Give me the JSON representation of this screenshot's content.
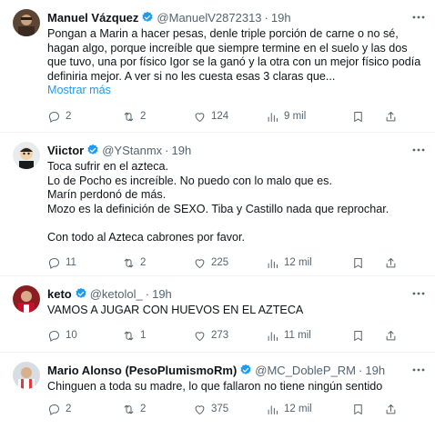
{
  "colors": {
    "text": "#0f1419",
    "muted": "#536471",
    "link": "#1d9bf0",
    "verified": "#1d9bf0",
    "divider": "#eff3f4"
  },
  "tweets": [
    {
      "name": "Manuel Vázquez",
      "verified": true,
      "handle": "@ManuelV2872313",
      "time": "19h",
      "text": "Pongan a Marin a hacer pesas, denle triple porción de carne o no sé, hagan algo, porque increíble que siempre termine en el suelo y las dos que tuvo, una por físico Igor se la ganó y la otra con un mejor físico podía definiria mejor. A ver si no les cuesta esas 3 claras que...",
      "show_more": "Mostrar más",
      "replies": "2",
      "retweets": "2",
      "likes": "124",
      "views": "9 mil"
    },
    {
      "name": "Viictor",
      "verified": true,
      "handle": "@YStanmx",
      "time": "19h",
      "text": "Toca sufrir en el azteca.\nLo de Pocho es increíble. No puedo con lo malo que es.\nMarín perdonó de más.\nMozo es la definición de SEXO. Tiba y Castillo nada que reprochar.\n\nCon todo al Azteca cabrones por favor.",
      "replies": "11",
      "retweets": "2",
      "likes": "225",
      "views": "12 mil"
    },
    {
      "name": "keto",
      "verified": true,
      "handle": "@ketolol_",
      "time": "19h",
      "text": "VAMOS A JUGAR CON HUEVOS EN EL AZTECA",
      "replies": "10",
      "retweets": "1",
      "likes": "273",
      "views": "11 mil"
    },
    {
      "name": "Mario Alonso (PesoPlumismoRm)",
      "verified": true,
      "handle": "@MC_DobleP_RM",
      "time": "19h",
      "text": "Chinguen a toda su madre, lo que fallaron no tiene ningún sentido",
      "replies": "2",
      "retweets": "2",
      "likes": "375",
      "views": "12 mil"
    }
  ]
}
